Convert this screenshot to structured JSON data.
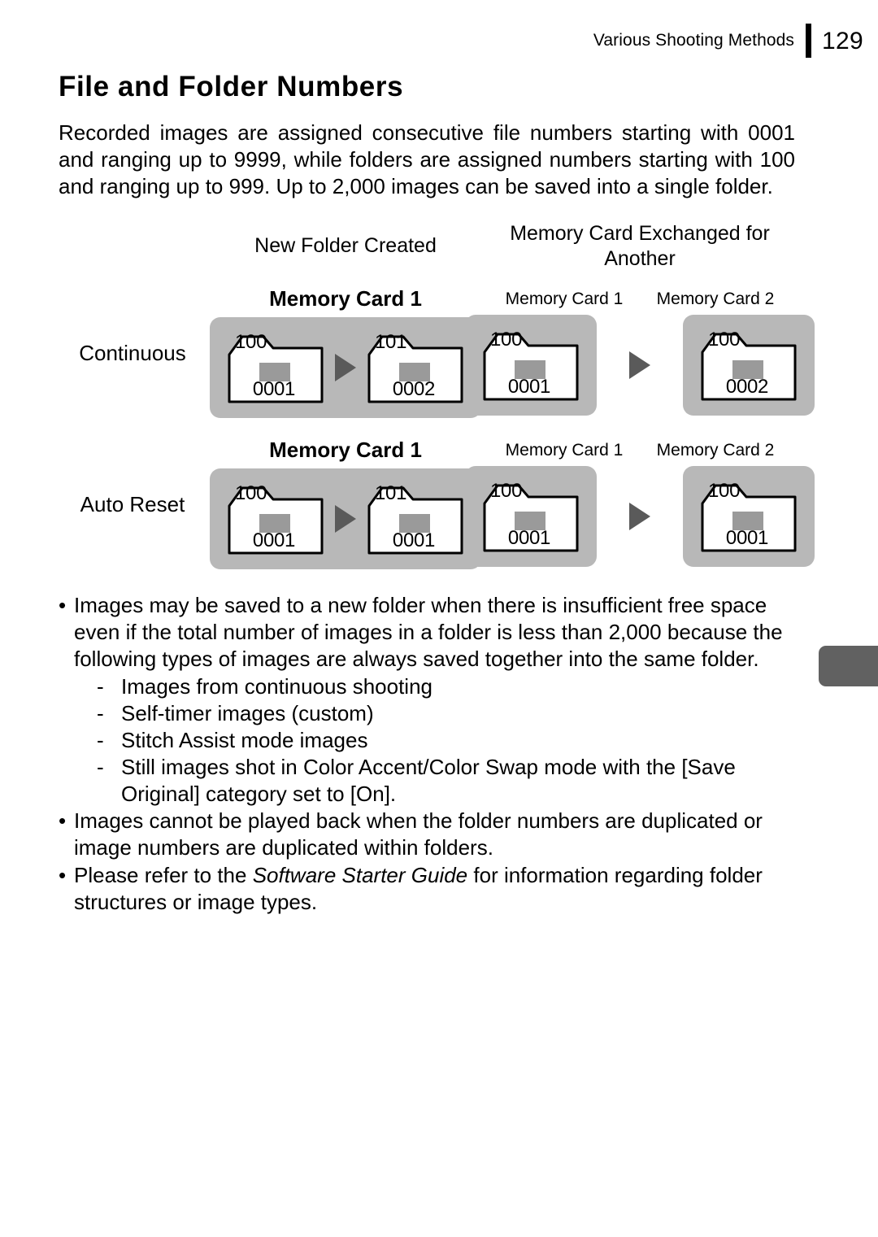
{
  "header": {
    "chapter": "Various Shooting Methods",
    "page_number": "129"
  },
  "title": "File and Folder Numbers",
  "intro": "Recorded images are assigned consecutive file numbers starting with 0001 and ranging up to 9999, while folders are assigned numbers starting with 100 and ranging up to 999. Up to 2,000 images can be saved into a single folder.",
  "table": {
    "corner_label": "",
    "columns": [
      "New Folder Created",
      "Memory Card Exchanged for Another"
    ],
    "rows": [
      {
        "mode": "Continuous",
        "new_folder": {
          "card_label": "Memory Card 1",
          "folders": [
            {
              "folder": "100",
              "image": "0001"
            },
            {
              "folder": "101",
              "image": "0002"
            }
          ]
        },
        "card_exchanged": {
          "card_label_1": "Memory Card 1",
          "card_label_2": "Memory Card 2",
          "folders": [
            {
              "folder": "100",
              "image": "0001"
            },
            {
              "folder": "100",
              "image": "0002"
            }
          ]
        }
      },
      {
        "mode": "Auto Reset",
        "new_folder": {
          "card_label": "Memory Card 1",
          "folders": [
            {
              "folder": "100",
              "image": "0001"
            },
            {
              "folder": "101",
              "image": "0001"
            }
          ]
        },
        "card_exchanged": {
          "card_label_1": "Memory Card 1",
          "card_label_2": "Memory Card 2",
          "folders": [
            {
              "folder": "100",
              "image": "0001"
            },
            {
              "folder": "100",
              "image": "0001"
            }
          ]
        }
      }
    ]
  },
  "notes": {
    "bullet_char": "•",
    "dash_char": "-",
    "items": [
      "Images may be saved to a new folder when there is insufficient free space even if the total number of images in a folder is less than 2,000 because the following types of images are always saved together into the same folder.",
      "Images cannot be played back when the folder numbers are duplicated or image numbers are duplicated within folders."
    ],
    "sub_items": [
      "Images from continuous shooting",
      "Self-timer images (custom)",
      "Stitch Assist mode images",
      "Still images shot in Color Accent/Color Swap mode with the [Save Original] category set to [On]."
    ],
    "final_note": {
      "before": "Please refer to the ",
      "italic": "Software Starter Guide",
      "after": " for information regarding folder structures or image types."
    }
  },
  "colors": {
    "panel_gray": "#b8b8b8",
    "thumb_tab_gray": "#616161",
    "arrow_gray": "#5a5a5a",
    "image_swatch_gray": "#9a9a9a",
    "rule_black": "#000000"
  }
}
